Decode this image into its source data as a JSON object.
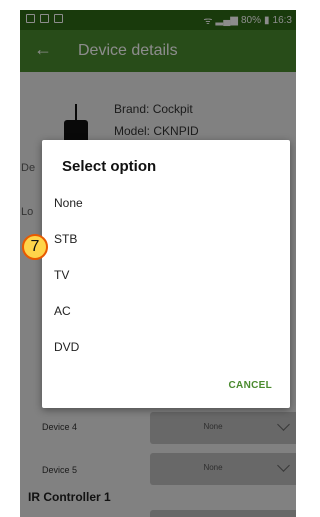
{
  "status_bar": {
    "battery": "80%",
    "time": "16:3"
  },
  "app_bar": {
    "title": "Device details"
  },
  "device": {
    "brand": "Brand: Cockpit",
    "model": "Model: CKNPID"
  },
  "rows": [
    {
      "label": "Device 4",
      "value": "None"
    },
    {
      "label": "Device 5",
      "value": "None"
    }
  ],
  "partial_labels": {
    "first": "De",
    "second": "Lo"
  },
  "section": {
    "title": "IR Controller 1"
  },
  "dialog": {
    "title": "Select option",
    "options": [
      "None",
      "STB",
      "TV",
      "AC",
      "DVD"
    ],
    "cancel": "CANCEL"
  },
  "badge": {
    "number": "7"
  },
  "colors": {
    "status_bar": "#2f6b17",
    "app_bar": "#4a8a2e",
    "accent": "#4a8a2e",
    "badge_fill": "#ffd54a",
    "badge_border": "#e85a00"
  }
}
